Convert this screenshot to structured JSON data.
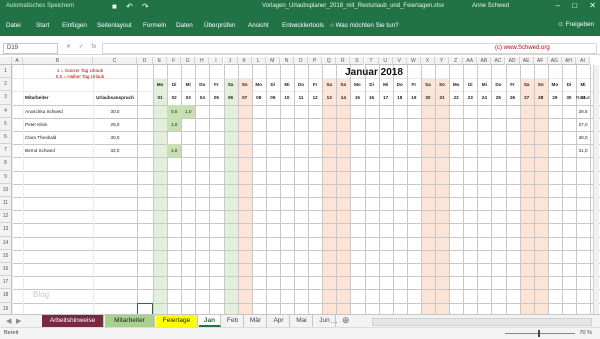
{
  "titlebar": {
    "autosave": "Automatisches Speichern",
    "document": "Vorlagen_Urlaubsplaner_2018_mit_Resturlaub_und_Feiertagen.xlsx",
    "user": "Anne Schwed"
  },
  "ribbon": {
    "tabs": [
      "Datei",
      "Start",
      "Einfügen",
      "Seitenlayout",
      "Formeln",
      "Daten",
      "Überprüfen",
      "Ansicht",
      "Entwicklertools"
    ],
    "tellme": "Was möchten Sie tun?",
    "share": "Freigeben"
  },
  "formula_bar": {
    "name_box": "D19",
    "fx": "fx",
    "copyright": "(c) www.Schwed.org"
  },
  "sheet": {
    "legend1": "1 = Ganzer Tag Urlaub",
    "legend2": "0,5 = Halber Tag Urlaub",
    "title": "Januar 2018",
    "hdr_employee": "Mitarbeiter",
    "hdr_entitlement": "Urlaubsanspruch",
    "hdr_rest": "Resturlaub",
    "watermark": "Blog",
    "col_letters": [
      "A",
      "B",
      "C",
      "D",
      "E",
      "F",
      "G",
      "H",
      "I",
      "J",
      "K",
      "L",
      "M",
      "N",
      "O",
      "P",
      "Q",
      "R",
      "S",
      "T",
      "U",
      "V",
      "W",
      "X",
      "Y",
      "Z",
      "AA",
      "AB",
      "AC",
      "AD",
      "AE",
      "AF",
      "AG",
      "AH",
      "AI"
    ],
    "row_numbers": [
      "1",
      "2",
      "3",
      "4",
      "5",
      "6",
      "7",
      "8",
      "9",
      "10",
      "11",
      "12",
      "13",
      "14",
      "15",
      "16",
      "17",
      "18",
      "19"
    ],
    "weekdays": [
      "Mo",
      "Di",
      "Mi",
      "Do",
      "Fr",
      "Sa",
      "So",
      "Mo",
      "Di",
      "Mi",
      "Do",
      "Fr",
      "Sa",
      "So",
      "Mo",
      "Di",
      "Mi",
      "Do",
      "Fr",
      "Sa",
      "So",
      "Mo",
      "Di",
      "Mi",
      "Do",
      "Fr",
      "Sa",
      "So",
      "Mo",
      "Di",
      "Mi"
    ],
    "days": [
      "01",
      "02",
      "03",
      "04",
      "05",
      "06",
      "07",
      "08",
      "09",
      "10",
      "11",
      "12",
      "13",
      "14",
      "15",
      "16",
      "17",
      "18",
      "19",
      "20",
      "21",
      "22",
      "23",
      "24",
      "25",
      "26",
      "27",
      "28",
      "29",
      "30",
      "31"
    ],
    "employees": [
      {
        "name": "Anuschka Schwed",
        "entitlement": "30,0",
        "rest": "28,5"
      },
      {
        "name": "Peter Klein",
        "entitlement": "28,0",
        "rest": "27,0"
      },
      {
        "name": "Clara Theobald",
        "entitlement": "30,0",
        "rest": "30,0"
      },
      {
        "name": "Bernd Schwed",
        "entitlement": "32,0",
        "rest": "31,0"
      }
    ],
    "entries": [
      {
        "row": 0,
        "day": 1,
        "value": "0,5"
      },
      {
        "row": 0,
        "day": 2,
        "value": "1,0"
      },
      {
        "row": 1,
        "day": 1,
        "value": "1,0"
      },
      {
        "row": 3,
        "day": 1,
        "value": "1,0"
      }
    ],
    "holiday_days": [
      0,
      5
    ],
    "weekend_days": [
      5,
      6,
      12,
      13,
      19,
      20,
      26,
      27
    ],
    "colors": {
      "weekend": "#fce4d6",
      "holiday": "#e2efda",
      "entry": "#c6e0b4"
    }
  },
  "sheet_tabs": [
    {
      "label": "Arbeitshinweise",
      "bg": "#7b2742",
      "fg": "#ffffff"
    },
    {
      "label": "Mitarbeiter",
      "bg": "#a9d08e",
      "fg": "#222222"
    },
    {
      "label": "Feiertage",
      "bg": "#ffff00",
      "fg": "#222222"
    },
    {
      "label": "Jan",
      "bg": "#ffffff",
      "fg": "#217346"
    },
    {
      "label": "Feb",
      "bg": "#f3f3f3",
      "fg": "#444444"
    },
    {
      "label": "Mär",
      "bg": "#f3f3f3",
      "fg": "#444444"
    },
    {
      "label": "Apr",
      "bg": "#f3f3f3",
      "fg": "#444444"
    },
    {
      "label": "Mai",
      "bg": "#f3f3f3",
      "fg": "#444444"
    },
    {
      "label": "Jun",
      "bg": "#f3f3f3",
      "fg": "#444444"
    }
  ],
  "status": {
    "ready": "Bereit",
    "zoom": "70 %"
  }
}
